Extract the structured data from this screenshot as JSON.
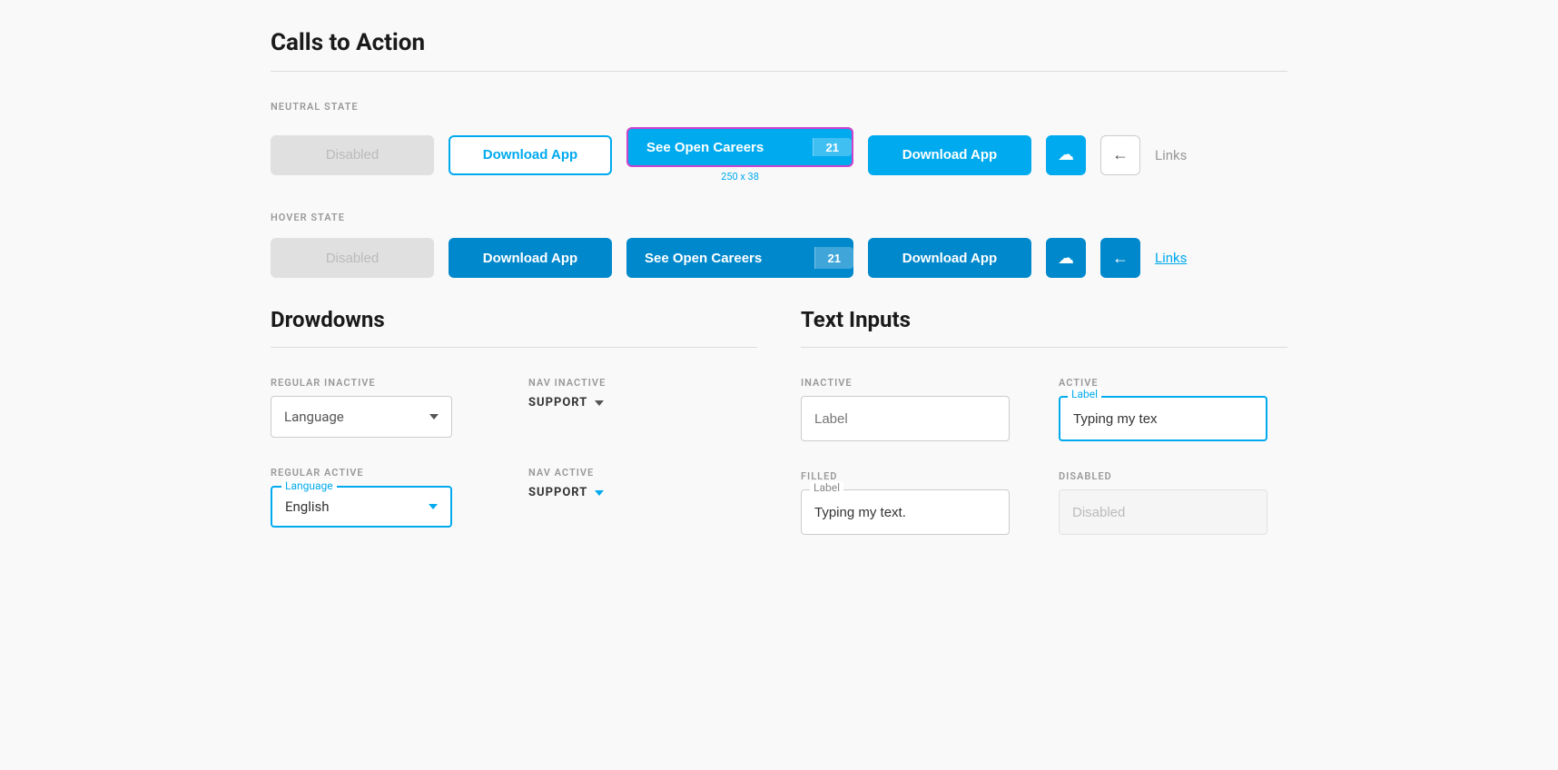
{
  "page": {
    "title": "Calls to Action"
  },
  "neutral_state": {
    "label": "NEUTRAL STATE",
    "disabled_btn": "Disabled",
    "outline_btn": "Download App",
    "careers_btn": "See Open Careers",
    "careers_badge": "21",
    "primary_btn": "Download App",
    "size_label": "250 x 38",
    "link_label": "Links"
  },
  "hover_state": {
    "label": "HOVER STATE",
    "disabled_btn": "Disabled",
    "outline_btn": "Download App",
    "careers_btn": "See Open Careers",
    "careers_badge": "21",
    "primary_btn": "Download App",
    "link_label": "Links"
  },
  "dropdowns": {
    "title": "Drowdowns",
    "regular_inactive_label": "REGULAR INACTIVE",
    "regular_inactive_value": "Language",
    "nav_inactive_label": "NAV INACTIVE",
    "nav_inactive_value": "SUPPORT",
    "regular_active_label": "REGULAR ACTIVE",
    "regular_active_value": "English",
    "regular_active_floating": "Language",
    "nav_active_label": "NAV ACTIVE",
    "nav_active_value": "SUPPORT"
  },
  "text_inputs": {
    "title": "Text Inputs",
    "inactive_label": "INACTIVE",
    "inactive_placeholder": "Label",
    "active_label": "ACTIVE",
    "active_floating": "Label",
    "active_value": "Typing my tex",
    "filled_label": "FILLED",
    "filled_floating": "Label",
    "filled_value": "Typing my text.",
    "disabled_label": "DISABLED",
    "disabled_value": "Disabled"
  },
  "icons": {
    "download": "⬇",
    "back_arrow": "←",
    "chevron_down": "▾"
  }
}
